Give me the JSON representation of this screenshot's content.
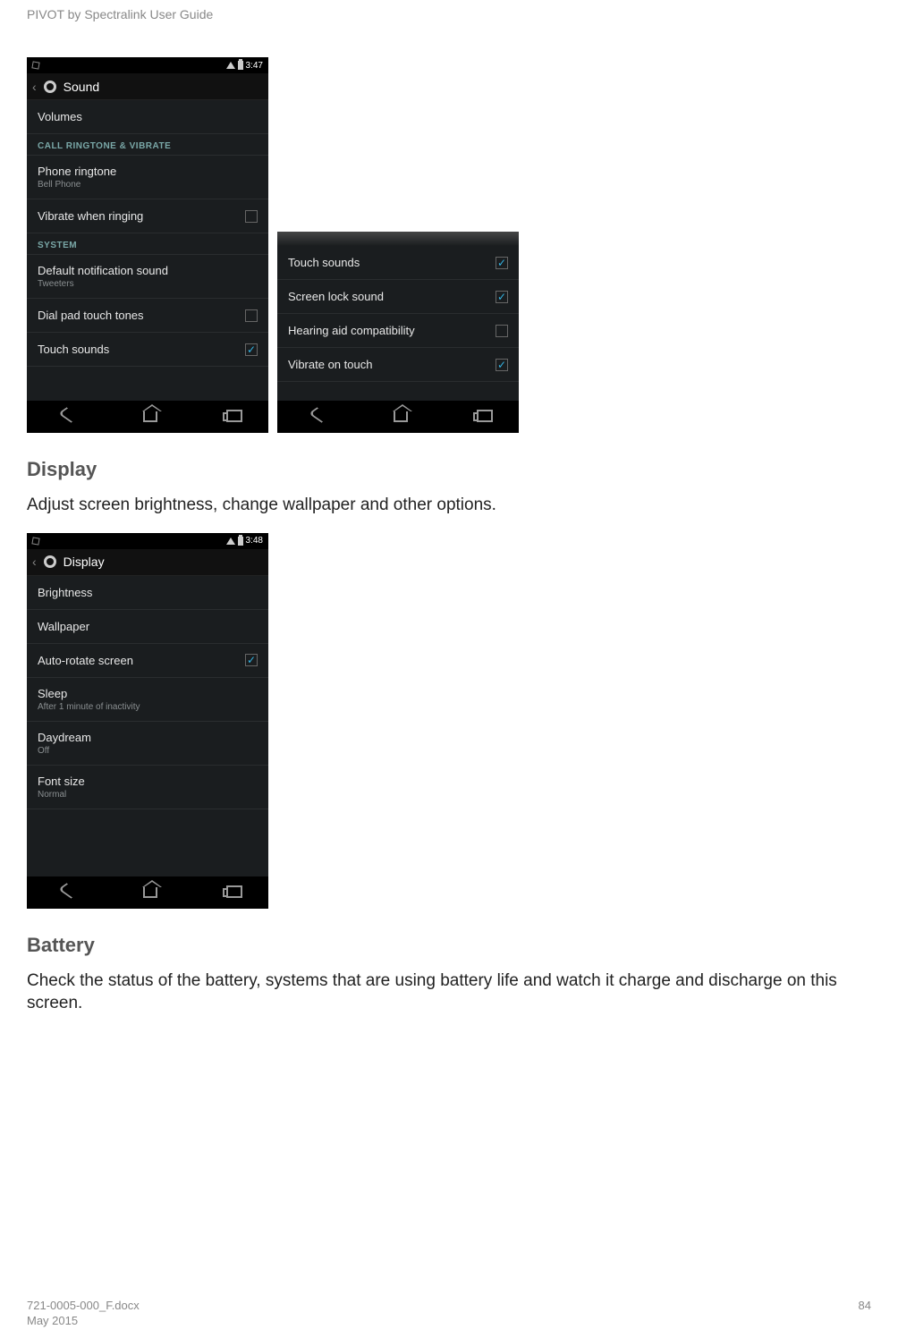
{
  "header": {
    "title": "PIVOT by Spectralink User Guide"
  },
  "sound_screen": {
    "time": "3:47",
    "app_bar": "Sound",
    "rows": {
      "volumes": "Volumes",
      "section1": "CALL RINGTONE & VIBRATE",
      "ringtone_label": "Phone ringtone",
      "ringtone_value": "Bell Phone",
      "vibrate_ring": "Vibrate when ringing",
      "section2": "SYSTEM",
      "default_notif_label": "Default notification sound",
      "default_notif_value": "Tweeters",
      "dial_pad": "Dial pad touch tones",
      "touch_sounds": "Touch sounds"
    }
  },
  "sound_screen_cont": {
    "rows": {
      "touch_sounds": "Touch sounds",
      "screen_lock": "Screen lock sound",
      "hearing_aid": "Hearing aid compatibility",
      "vibrate_touch": "Vibrate on touch"
    }
  },
  "display_section": {
    "heading": "Display",
    "body": "Adjust screen brightness, change wallpaper and other options."
  },
  "display_screen": {
    "time": "3:48",
    "app_bar": "Display",
    "rows": {
      "brightness": "Brightness",
      "wallpaper": "Wallpaper",
      "auto_rotate": "Auto-rotate screen",
      "sleep_label": "Sleep",
      "sleep_value": "After 1 minute of inactivity",
      "daydream_label": "Daydream",
      "daydream_value": "Off",
      "font_label": "Font size",
      "font_value": "Normal"
    }
  },
  "battery_section": {
    "heading": "Battery",
    "body": "Check the status of the battery, systems that are using battery life and watch it charge and discharge on this screen."
  },
  "footer": {
    "file": "721-0005-000_F.docx",
    "date": "May 2015",
    "page": "84"
  }
}
